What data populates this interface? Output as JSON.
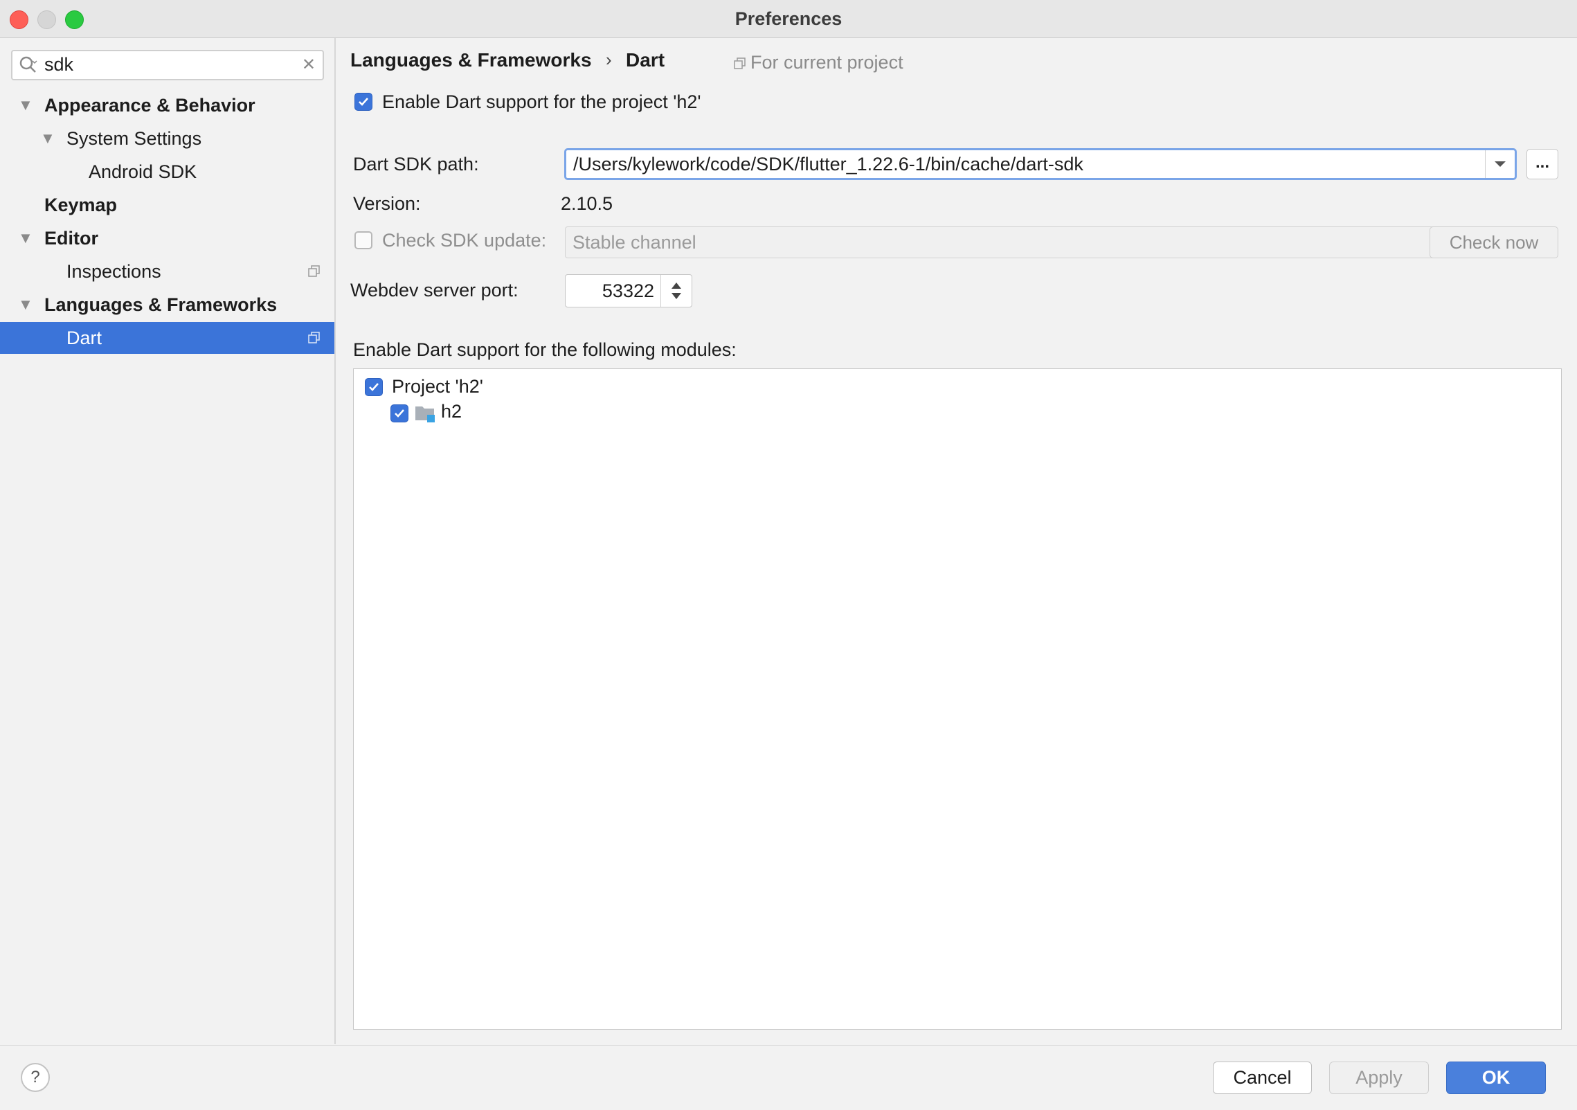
{
  "window": {
    "title": "Preferences"
  },
  "sidebar": {
    "search_value": "sdk",
    "items": [
      {
        "label": "Appearance & Behavior"
      },
      {
        "label": "System Settings"
      },
      {
        "label": "Android SDK"
      },
      {
        "label": "Keymap"
      },
      {
        "label": "Editor"
      },
      {
        "label": "Inspections"
      },
      {
        "label": "Languages & Frameworks"
      },
      {
        "label": "Dart"
      }
    ]
  },
  "content": {
    "breadcrumb": {
      "parent": "Languages & Frameworks",
      "separator": "›",
      "current": "Dart"
    },
    "scope_label": "For current project",
    "enable_dart_label": "Enable Dart support for the project 'h2'",
    "sdk_path_label": "Dart SDK path:",
    "sdk_path_value": "/Users/kylework/code/SDK/flutter_1.22.6-1/bin/cache/dart-sdk",
    "browse_label": "...",
    "version_label": "Version:",
    "version_value": "2.10.5",
    "check_update_label": "Check SDK update:",
    "channel_value": "Stable channel",
    "check_now_label": "Check now",
    "webdev_port_label": "Webdev server port:",
    "webdev_port_value": "53322",
    "modules_label": "Enable Dart support for the following modules:",
    "modules": [
      {
        "label": "Project 'h2'"
      },
      {
        "label": "h2"
      }
    ]
  },
  "footer": {
    "help_label": "?",
    "cancel_label": "Cancel",
    "apply_label": "Apply",
    "ok_label": "OK"
  },
  "colors": {
    "accent": "#3b74d9",
    "ok_button": "#4a80dc",
    "window_bg": "#f2f2f2"
  }
}
